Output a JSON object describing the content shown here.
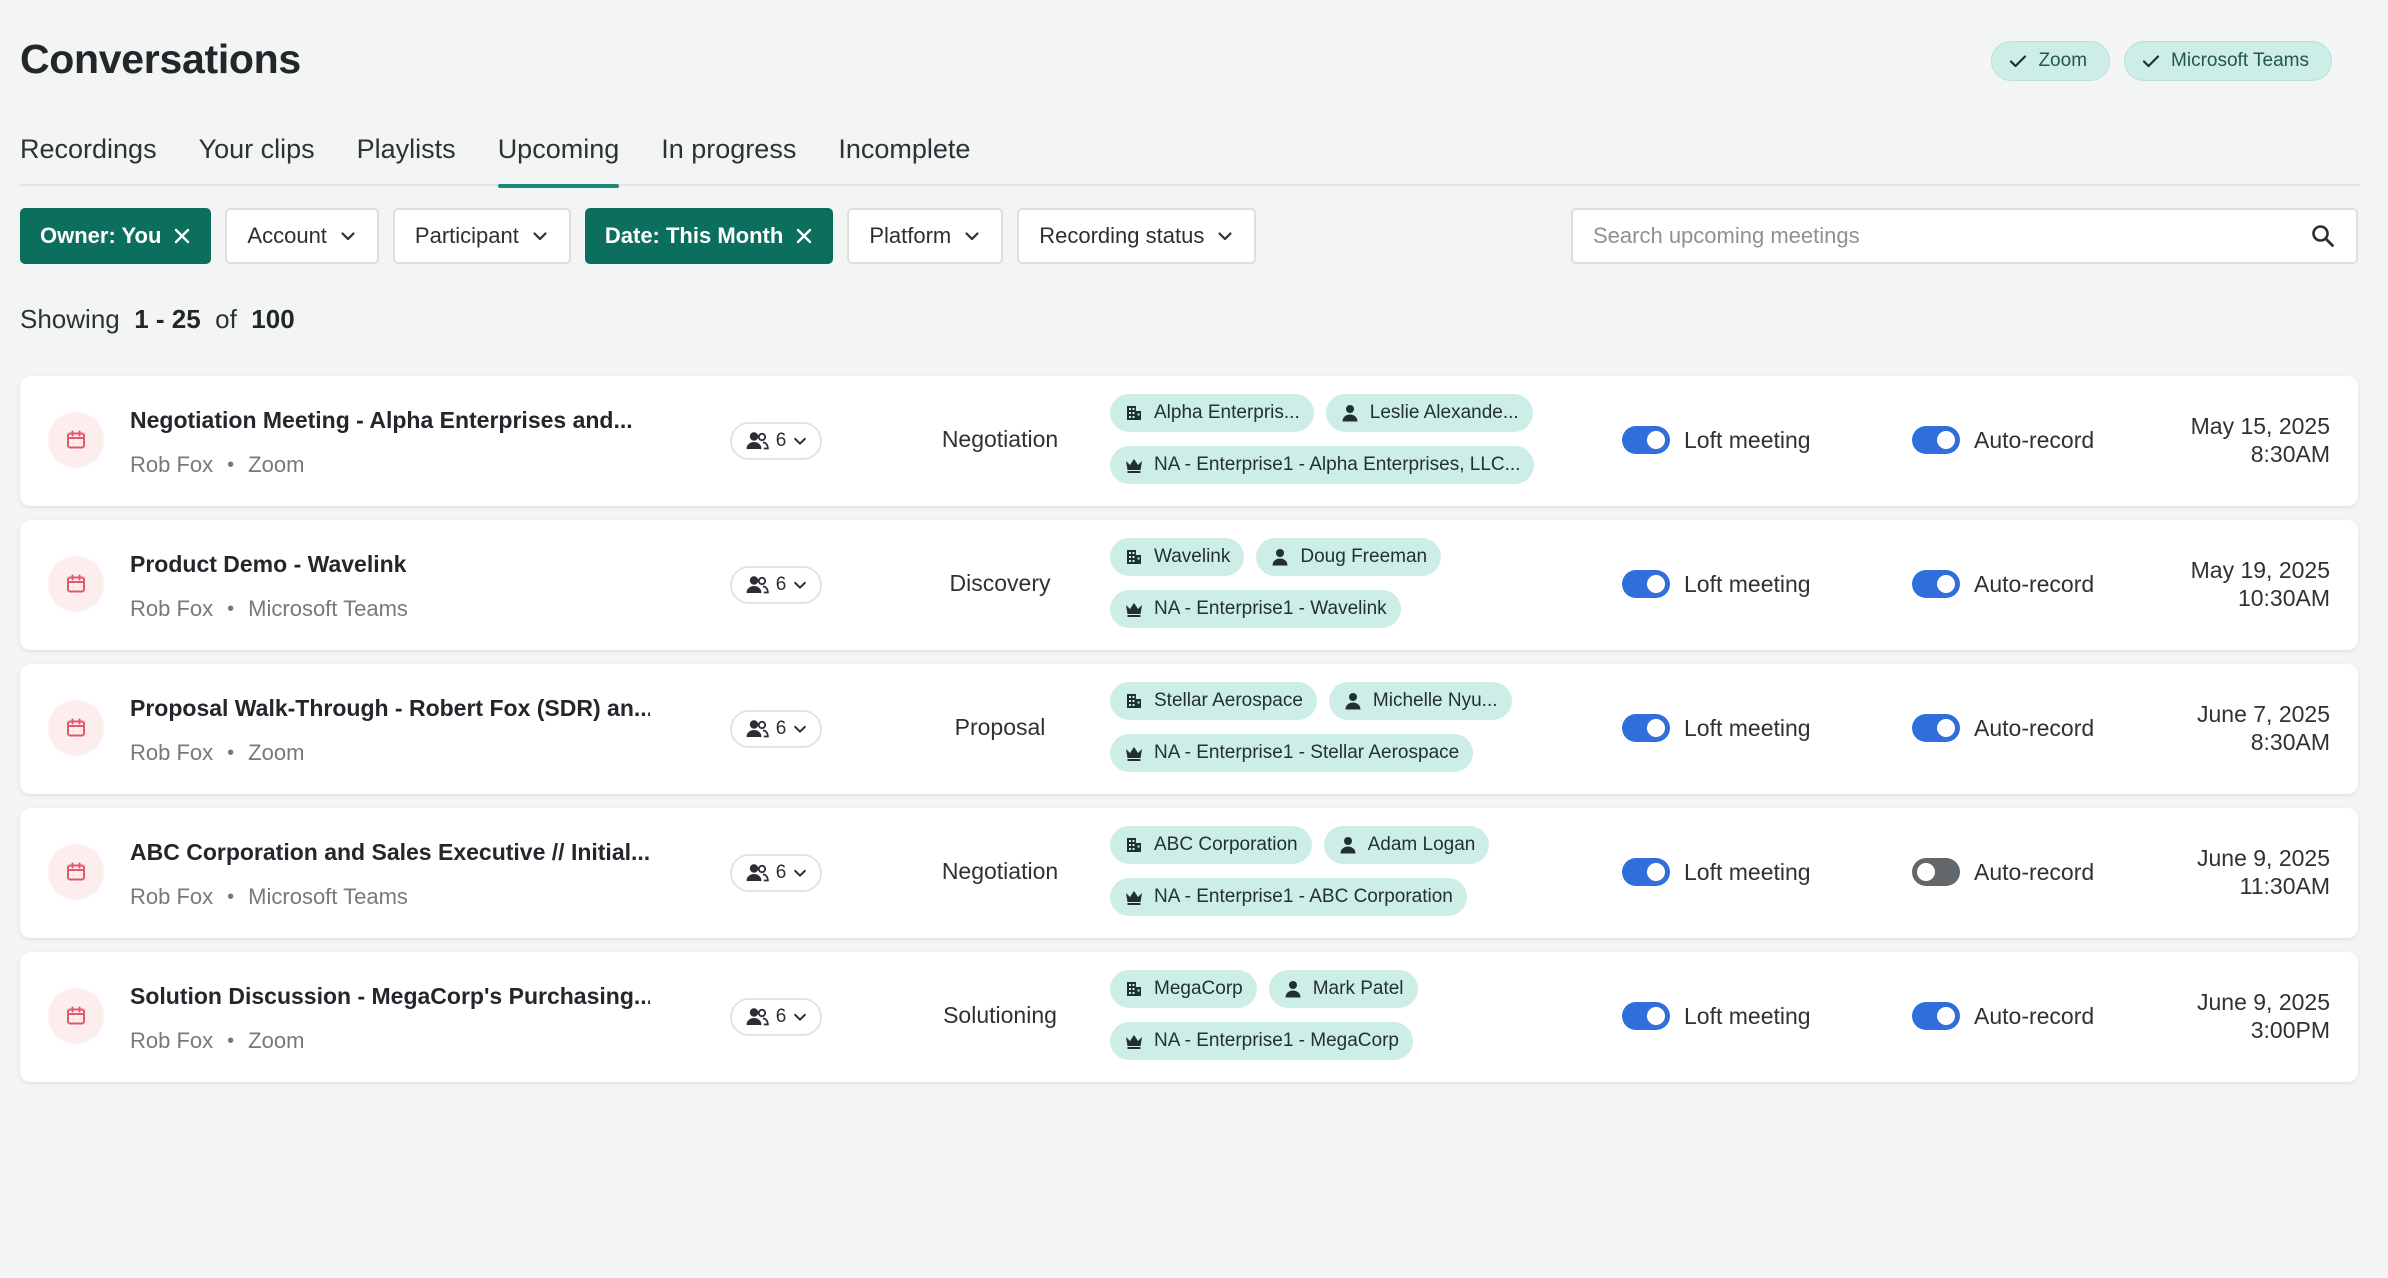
{
  "header": {
    "title": "Conversations",
    "integrations": [
      {
        "label": "Zoom"
      },
      {
        "label": "Microsoft Teams"
      }
    ]
  },
  "tabs": [
    {
      "label": "Recordings"
    },
    {
      "label": "Your clips"
    },
    {
      "label": "Playlists"
    },
    {
      "label": "Upcoming",
      "active": true
    },
    {
      "label": "In progress"
    },
    {
      "label": "Incomplete"
    }
  ],
  "filters": {
    "owner": "Owner: You",
    "account": "Account",
    "participant": "Participant",
    "date": "Date: This Month",
    "platform": "Platform",
    "recording_status": "Recording status"
  },
  "search": {
    "placeholder": "Search upcoming meetings",
    "value": ""
  },
  "showing": {
    "prefix": "Showing",
    "range": "1 - 25",
    "of": "of",
    "total": "100"
  },
  "toggle_labels": {
    "loft": "Loft meeting",
    "auto": "Auto-record"
  },
  "colors": {
    "accent": "#0c6e5d",
    "tag_bg": "#cdeee6",
    "toggle_on": "#2f6edb",
    "toggle_off": "#62676c",
    "calendar_icon": "#e5566a"
  },
  "meetings": [
    {
      "title": "Negotiation Meeting - Alpha Enterprises and...",
      "owner": "Rob Fox",
      "platform": "Zoom",
      "participants": "6",
      "stage": "Negotiation",
      "account": "Alpha Enterpris...",
      "contact": "Leslie Alexande...",
      "opportunity": "NA - Enterprise1 - Alpha Enterprises, LLC...",
      "loft": true,
      "auto_record": true,
      "date": "May 15, 2025",
      "time": "8:30AM"
    },
    {
      "title": "Product Demo - Wavelink",
      "owner": "Rob Fox",
      "platform": "Microsoft Teams",
      "participants": "6",
      "stage": "Discovery",
      "account": "Wavelink",
      "contact": "Doug Freeman",
      "opportunity": "NA - Enterprise1 - Wavelink",
      "loft": true,
      "auto_record": true,
      "date": "May 19, 2025",
      "time": "10:30AM"
    },
    {
      "title": "Proposal Walk-Through - Robert Fox (SDR) an...",
      "owner": "Rob Fox",
      "platform": "Zoom",
      "participants": "6",
      "stage": "Proposal",
      "account": "Stellar Aerospace",
      "contact": "Michelle Nyu...",
      "opportunity": "NA - Enterprise1 - Stellar Aerospace",
      "loft": true,
      "auto_record": true,
      "date": "June 7, 2025",
      "time": "8:30AM"
    },
    {
      "title": "ABC Corporation and Sales Executive // Initial...",
      "owner": "Rob Fox",
      "platform": "Microsoft Teams",
      "participants": "6",
      "stage": "Negotiation",
      "account": "ABC Corporation",
      "contact": "Adam Logan",
      "opportunity": "NA - Enterprise1 - ABC Corporation",
      "loft": true,
      "auto_record": false,
      "date": "June 9, 2025",
      "time": "11:30AM"
    },
    {
      "title": "Solution Discussion - MegaCorp's Purchasing...",
      "owner": "Rob Fox",
      "platform": "Zoom",
      "participants": "6",
      "stage": "Solutioning",
      "account": "MegaCorp",
      "contact": "Mark Patel",
      "opportunity": "NA - Enterprise1 - MegaCorp",
      "loft": true,
      "auto_record": true,
      "date": "June 9, 2025",
      "time": "3:00PM"
    }
  ]
}
